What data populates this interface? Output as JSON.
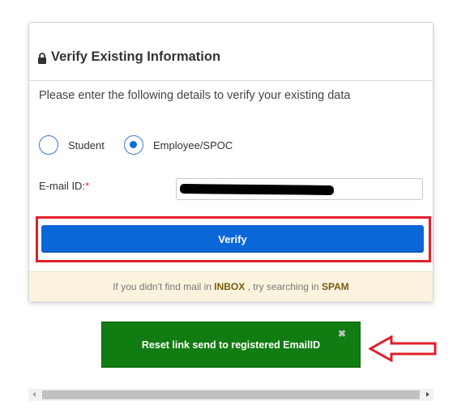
{
  "panel": {
    "title": "Verify Existing Information",
    "lock_icon": "lock-icon",
    "instructions": "Please enter the following details to verify your existing data",
    "user_type_options": [
      {
        "label": "Student",
        "checked": false
      },
      {
        "label": "Employee/SPOC",
        "checked": true
      }
    ],
    "email": {
      "label": "E-mail ID:",
      "required_marker": "*",
      "value": "",
      "redacted": true
    },
    "verify_label": "Verify",
    "notice": {
      "prefix": "If you didn't find mail in ",
      "inbox": "INBOX",
      "middle": " , try searching in ",
      "spam": "SPAM"
    }
  },
  "toast": {
    "message": "Reset link send to registered EmailID",
    "close_icon": "✖"
  },
  "colors": {
    "primary_button": "#0a67d8",
    "toast_background": "#117c11",
    "annotation_red": "#e0202a",
    "notice_background": "#fbf3dd"
  }
}
